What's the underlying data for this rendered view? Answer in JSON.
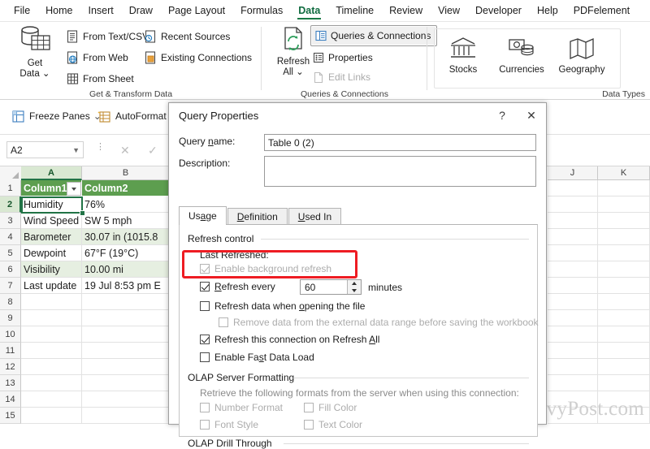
{
  "ribbon": {
    "tabs": [
      {
        "label": "File",
        "active": false
      },
      {
        "label": "Home",
        "active": false
      },
      {
        "label": "Insert",
        "active": false
      },
      {
        "label": "Draw",
        "active": false
      },
      {
        "label": "Page Layout",
        "active": false
      },
      {
        "label": "Formulas",
        "active": false
      },
      {
        "label": "Data",
        "active": true
      },
      {
        "label": "Timeline",
        "active": false
      },
      {
        "label": "Review",
        "active": false
      },
      {
        "label": "View",
        "active": false
      },
      {
        "label": "Developer",
        "active": false
      },
      {
        "label": "Help",
        "active": false
      },
      {
        "label": "PDFelement",
        "active": false
      }
    ],
    "groups": {
      "get_transform": {
        "label": "Get & Transform Data",
        "get_data": "Get\nData",
        "get_data_line1": "Get",
        "get_data_line2": "Data",
        "items": [
          {
            "label": "From Text/CSV",
            "icon": "text-csv-icon",
            "disabled": false
          },
          {
            "label": "From Web",
            "icon": "web-icon",
            "disabled": false
          },
          {
            "label": "From Sheet",
            "icon": "sheet-icon",
            "disabled": false
          },
          {
            "label": "Recent Sources",
            "icon": "recent-sources-icon",
            "disabled": false
          },
          {
            "label": "Existing Connections",
            "icon": "existing-connections-icon",
            "disabled": false
          }
        ]
      },
      "queries_connections": {
        "label": "Queries & Connections",
        "refresh_all_line1": "Refresh",
        "refresh_all_line2": "All",
        "items": [
          {
            "label": "Queries & Connections",
            "icon": "queries-connections-icon",
            "disabled": false,
            "framed": true
          },
          {
            "label": "Properties",
            "icon": "properties-icon",
            "disabled": false,
            "framed": false
          },
          {
            "label": "Edit Links",
            "icon": "edit-links-icon",
            "disabled": true,
            "framed": false
          }
        ]
      },
      "data_types": {
        "label": "Data Types",
        "items": [
          {
            "label": "Stocks",
            "icon": "stocks-icon"
          },
          {
            "label": "Currencies",
            "icon": "currencies-icon"
          },
          {
            "label": "Geography",
            "icon": "geography-icon"
          }
        ]
      }
    },
    "secondary_row": [
      {
        "label": "Freeze Panes",
        "icon": "freeze-panes-icon",
        "caret": true
      },
      {
        "label": "AutoFormat",
        "icon": "autoformat-icon",
        "caret": false
      }
    ]
  },
  "formula_bar": {
    "name_box_value": "A2",
    "cancel_icon": "close-icon",
    "confirm_icon": "check-icon",
    "insert_function_icon": "more-icon"
  },
  "grid": {
    "columns": [
      "A",
      "B",
      "J",
      "K"
    ],
    "selected_column": "A",
    "row_numbers": [
      "1",
      "2",
      "3",
      "4",
      "5",
      "6",
      "7",
      "8",
      "9",
      "10",
      "11",
      "12",
      "13",
      "14",
      "15"
    ],
    "selected_row": "2",
    "table": {
      "headers": [
        "Column1",
        "Column2"
      ],
      "rows": [
        {
          "c1": "Humidity",
          "c2": "76%"
        },
        {
          "c1": "Wind Speed",
          "c2": "SW 5 mph"
        },
        {
          "c1": "Barometer",
          "c2": "30.07 in (1015.8"
        },
        {
          "c1": "Dewpoint",
          "c2": "67°F (19°C)"
        },
        {
          "c1": "Visibility",
          "c2": "10.00 mi"
        },
        {
          "c1": "Last update",
          "c2": "19 Jul 8:53 pm E"
        }
      ]
    },
    "watermark": "groovyPost.com"
  },
  "dialog": {
    "title": "Query Properties",
    "help_icon": "?",
    "close_icon": "✕",
    "query_name_label": "Query name:",
    "query_name_value": "Table 0 (2)",
    "description_label": "Description:",
    "description_value": "",
    "tabs": [
      {
        "label": "Usage",
        "active": true
      },
      {
        "label": "Definition",
        "active": false
      },
      {
        "label": "Used In",
        "active": false
      }
    ],
    "refresh_control": {
      "group_title": "Refresh control",
      "last_refreshed_label": "Last Refreshed:",
      "checkboxes": [
        {
          "label": "Enable background refresh",
          "checked": true,
          "disabled": true
        },
        {
          "label": "Refresh every",
          "checked": true,
          "disabled": false,
          "highlighted": true
        },
        {
          "label": "Refresh data when opening the file",
          "checked": false,
          "disabled": false
        },
        {
          "label": "Remove data from the external data range before saving the workbook",
          "checked": false,
          "disabled": true
        },
        {
          "label": "Refresh this connection on Refresh All",
          "checked": true,
          "disabled": false
        },
        {
          "label": "Enable Fast Data Load",
          "checked": false,
          "disabled": false
        }
      ],
      "refresh_interval_value": "60",
      "refresh_interval_unit": "minutes"
    },
    "olap_server_formatting": {
      "group_title": "OLAP Server Formatting",
      "description": "Retrieve the following formats from the server when using this connection:",
      "checkboxes": [
        {
          "label": "Number Format",
          "checked": false,
          "disabled": true
        },
        {
          "label": "Fill Color",
          "checked": false,
          "disabled": true
        },
        {
          "label": "Font Style",
          "checked": false,
          "disabled": true
        },
        {
          "label": "Text Color",
          "checked": false,
          "disabled": true
        }
      ]
    },
    "olap_drill_through": {
      "group_title": "OLAP Drill Through"
    }
  },
  "colors": {
    "accent_green": "#217346",
    "table_header_green": "#5d9e4f",
    "table_band_green": "#e6efe1",
    "highlight_red": "#ee1c23"
  }
}
